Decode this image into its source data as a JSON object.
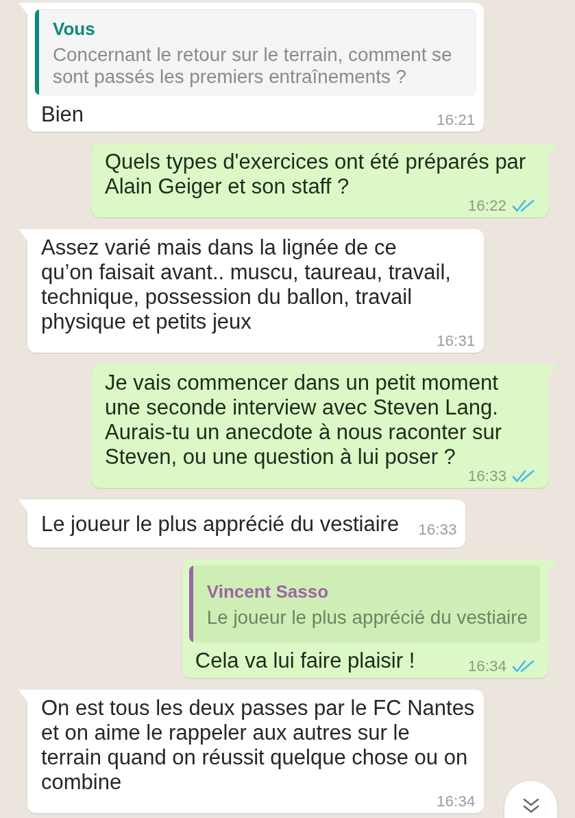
{
  "messages": [
    {
      "kind": "incoming",
      "quote": {
        "author": "Vous",
        "text": "Concernant le retour sur le terrain, comment se sont passés les premiers entraînements ?",
        "color": "#0a8a7a"
      },
      "text": "Bien",
      "time": "16:21"
    },
    {
      "kind": "outgoing",
      "text": "Quels types d'exercices ont été préparés par Alain Geiger et son staff ?",
      "time": "16:22",
      "read": true
    },
    {
      "kind": "incoming",
      "text": "Assez varié mais dans la lignée de ce\nqu’on faisait avant.. muscu, taureau, travail, technique, possession du ballon, travail physique et petits jeux",
      "time": "16:31"
    },
    {
      "kind": "outgoing",
      "text": "Je vais commencer dans un petit moment une seconde interview avec Steven Lang. Aurais-tu un anecdote à nous raconter sur Steven, ou une question à lui poser ?",
      "time": "16:33",
      "read": true
    },
    {
      "kind": "incoming",
      "text": "Le joueur le plus apprécié du vestiaire",
      "time": "16:33"
    },
    {
      "kind": "outgoing",
      "quote": {
        "author": "Vincent Sasso",
        "text": "Le joueur le plus apprécié du vestiaire",
        "color": "#9a66a6"
      },
      "text": "Cela va lui faire plaisir !",
      "time": "16:34",
      "read": true
    },
    {
      "kind": "incoming",
      "text": "On est tous les deux passes par le FC Nantes et on aime le rappeler aux autres sur le terrain quand on réussit quelque chose ou on combine",
      "time": "16:34"
    }
  ]
}
